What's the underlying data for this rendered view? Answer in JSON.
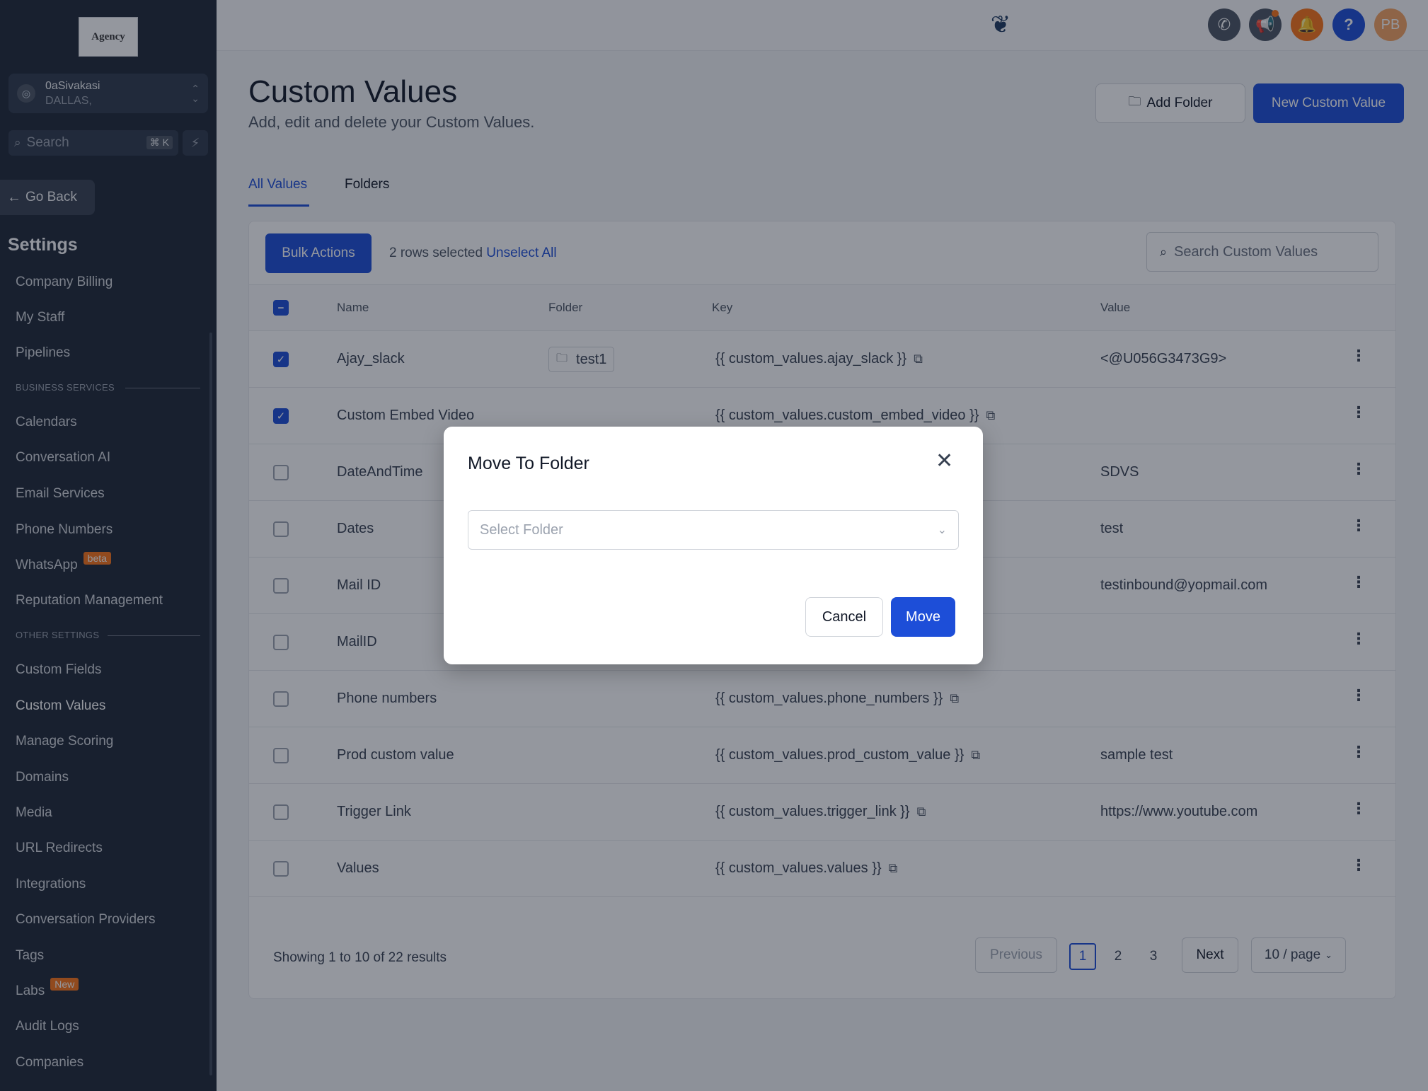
{
  "sidebar": {
    "logo_text": "Agency",
    "account": {
      "name": "0aSivakasi",
      "location": "DALLAS,"
    },
    "search": {
      "placeholder": "Search",
      "shortcut": "⌘ K"
    },
    "go_back": "Go Back",
    "settings_title": "Settings",
    "top_items": [
      "Company Billing",
      "My Staff",
      "Pipelines"
    ],
    "business_services_label": "BUSINESS SERVICES",
    "business_items": [
      "Calendars",
      "Conversation AI",
      "Email Services",
      "Phone Numbers",
      "WhatsApp",
      "Reputation Management"
    ],
    "whatsapp_badge": "beta",
    "other_settings_label": "OTHER SETTINGS",
    "other_items": [
      "Custom Fields",
      "Custom Values",
      "Manage Scoring",
      "Domains",
      "Media",
      "URL Redirects",
      "Integrations",
      "Conversation Providers",
      "Tags",
      "Labs",
      "Audit Logs",
      "Companies"
    ],
    "labs_badge": "New",
    "active_item": "Custom Values"
  },
  "topbar": {
    "avatar_initials": "PB",
    "icons": [
      "phone-icon",
      "megaphone-icon",
      "bell-icon",
      "help-icon"
    ],
    "colors": {
      "phone": "#4b5563",
      "megaphone": "#4b5563",
      "bell": "#f97316",
      "help": "#1d4ed8",
      "avatar": "#f4a261"
    }
  },
  "page": {
    "title": "Custom Values",
    "subtitle": "Add, edit and delete your Custom Values.",
    "add_folder_label": "Add Folder",
    "new_value_label": "New Custom Value",
    "tabs": [
      "All Values",
      "Folders"
    ],
    "active_tab": "All Values"
  },
  "table": {
    "bulk_actions_label": "Bulk Actions",
    "selected_text": "2 rows selected",
    "unselect_label": "Unselect All",
    "search_placeholder": "Search Custom Values",
    "columns": [
      "Name",
      "Folder",
      "Key",
      "Value"
    ],
    "rows": [
      {
        "checked": true,
        "name": "Ajay_slack",
        "folder": "test1",
        "key": "{{ custom_values.ajay_slack }}",
        "value": "<@U056G3473G9>"
      },
      {
        "checked": true,
        "name": "Custom Embed Video",
        "folder": "",
        "key": "{{ custom_values.custom_embed_video }}",
        "value": ""
      },
      {
        "checked": false,
        "name": "DateAndTime",
        "folder": "",
        "key": "",
        "value": "SDVS"
      },
      {
        "checked": false,
        "name": "Dates",
        "folder": "",
        "key": "",
        "value": "test"
      },
      {
        "checked": false,
        "name": "Mail ID",
        "folder": "",
        "key": "",
        "value": "testinbound@yopmail.com"
      },
      {
        "checked": false,
        "name": "MailID",
        "folder": "",
        "key": "",
        "value": ""
      },
      {
        "checked": false,
        "name": "Phone numbers",
        "folder": "",
        "key": "{{ custom_values.phone_numbers }}",
        "value": ""
      },
      {
        "checked": false,
        "name": "Prod custom value",
        "folder": "",
        "key": "{{ custom_values.prod_custom_value }}",
        "value": "sample test"
      },
      {
        "checked": false,
        "name": "Trigger Link",
        "folder": "",
        "key": "{{ custom_values.trigger_link }}",
        "value": "https://www.youtube.com"
      },
      {
        "checked": false,
        "name": "Values",
        "folder": "",
        "key": "{{ custom_values.values }}",
        "value": ""
      }
    ]
  },
  "pagination": {
    "showing_text": "Showing 1 to 10 of 22 results",
    "previous_label": "Previous",
    "pages": [
      "1",
      "2",
      "3"
    ],
    "current_page": "1",
    "next_label": "Next",
    "page_size": "10 / page"
  },
  "modal": {
    "title": "Move To Folder",
    "select_placeholder": "Select Folder",
    "cancel_label": "Cancel",
    "move_label": "Move"
  },
  "accent_color": "#1d4ed8"
}
